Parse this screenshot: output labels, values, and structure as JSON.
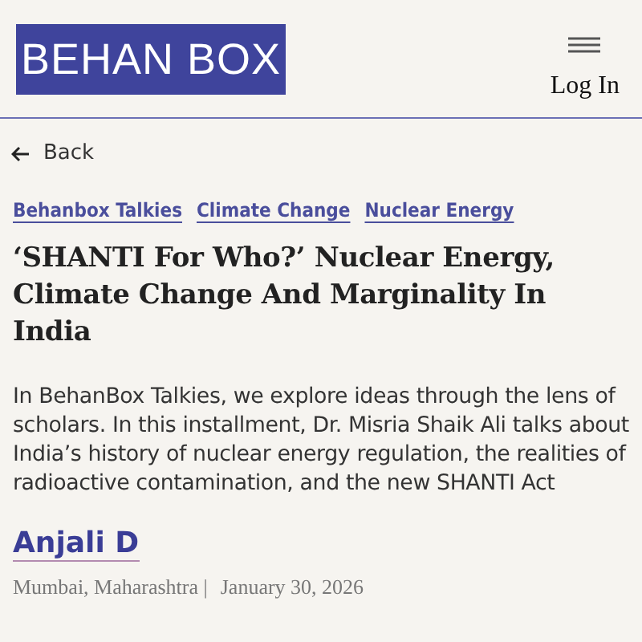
{
  "header": {
    "logo": "BEHAN BOX",
    "login": "Log In"
  },
  "back": "Back",
  "tags": [
    "Behanbox Talkies",
    "Climate Change",
    "Nuclear Energy"
  ],
  "title": "‘SHANTI For Who?’ Nuclear Energy, Climate Change And Marginality In India",
  "summary": "In BehanBox Talkies, we explore ideas through the lens of scholars. In this installment, Dr. Misria Shaik Ali talks about India’s history of nuclear energy regulation, the realities of radioactive contamination, and the new SHANTI Act",
  "author": "Anjali D",
  "location": "Mumbai, Maharashtra |",
  "date": "January 30, 2026"
}
